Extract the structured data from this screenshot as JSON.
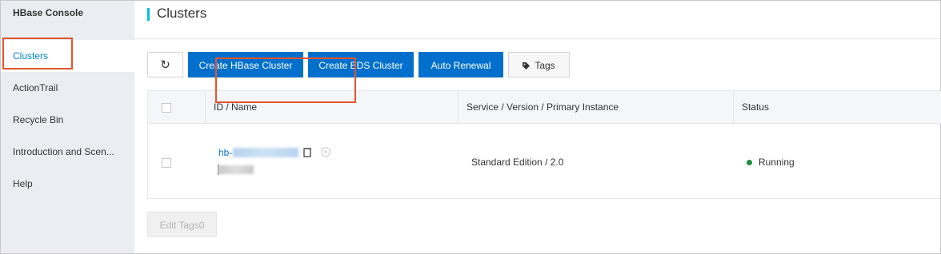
{
  "sidebar": {
    "title": "HBase Console",
    "items": [
      {
        "label": "Clusters"
      },
      {
        "label": "ActionTrail"
      },
      {
        "label": "Recycle Bin"
      },
      {
        "label": "Introduction and Scen..."
      },
      {
        "label": "Help"
      }
    ]
  },
  "header": {
    "title": "Clusters"
  },
  "toolbar": {
    "refresh_icon": "↻",
    "create_hbase_label": "Create HBase Cluster",
    "create_bds_label": "Create BDS Cluster",
    "auto_renewal_label": "Auto Renewal",
    "tags_label": "Tags"
  },
  "table": {
    "columns": [
      "ID / Name",
      "Service / Version / Primary Instance",
      "Status"
    ],
    "rows": [
      {
        "id_prefix": "hb-",
        "service_version": "Standard Edition / 2.0",
        "status": "Running"
      }
    ]
  },
  "footer": {
    "edit_tags_label": "Edit Tags0"
  },
  "colors": {
    "accent": "#0070cc",
    "sidebar_bg": "#eaedf1",
    "highlight_box": "#e4532e",
    "status_running": "#1e8e3e",
    "header_bar": "#00c1de"
  }
}
